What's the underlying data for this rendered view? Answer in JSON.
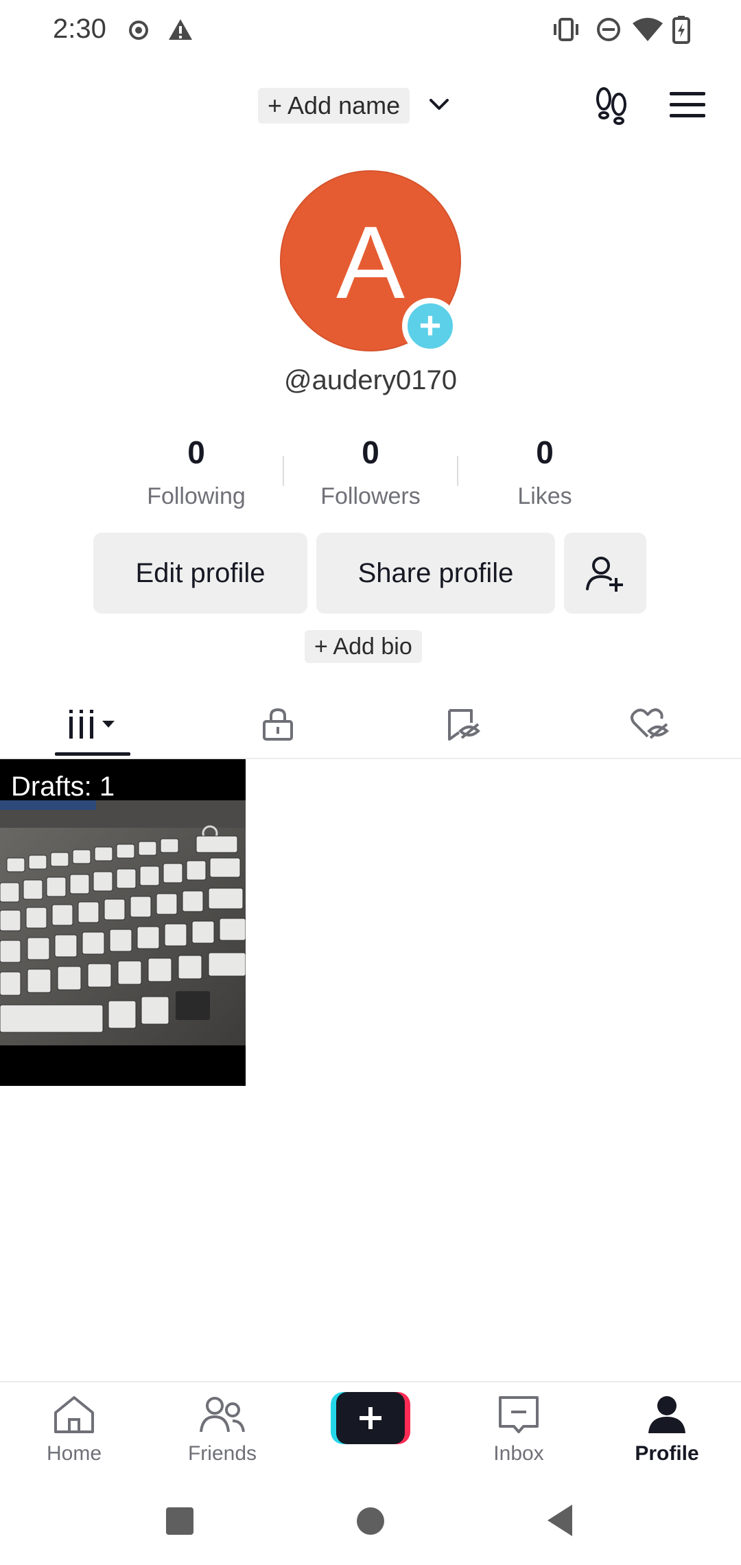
{
  "status_bar": {
    "time": "2:30",
    "icons": [
      "record-icon",
      "warning-icon",
      "vibrate-icon",
      "do-not-disturb-icon",
      "wifi-icon",
      "battery-charging-icon"
    ]
  },
  "header": {
    "add_name": "+ Add name",
    "icons": [
      "chevron-down-icon",
      "footprints-icon",
      "menu-icon"
    ]
  },
  "profile": {
    "avatar_letter": "A",
    "avatar_color": "#e65c32",
    "username": "@audery0170"
  },
  "stats": [
    {
      "value": "0",
      "label": "Following"
    },
    {
      "value": "0",
      "label": "Followers"
    },
    {
      "value": "0",
      "label": "Likes"
    }
  ],
  "actions": {
    "edit_profile": "Edit profile",
    "share_profile": "Share profile",
    "add_bio": "+ Add bio"
  },
  "tabs": [
    "grid-icon",
    "lock-icon",
    "repost-hidden-icon",
    "liked-hidden-icon"
  ],
  "drafts": {
    "label": "Drafts: 1"
  },
  "bottom_nav": [
    {
      "label": "Home",
      "icon": "home-icon",
      "active": false
    },
    {
      "label": "Friends",
      "icon": "friends-icon",
      "active": false
    },
    {
      "label": "",
      "icon": "create-icon",
      "active": false
    },
    {
      "label": "Inbox",
      "icon": "inbox-icon",
      "active": false
    },
    {
      "label": "Profile",
      "icon": "profile-icon",
      "active": true
    }
  ],
  "colors": {
    "accent_cyan": "#25f4ee",
    "accent_pink": "#fe2c55",
    "plus_badge": "#5bd0e8"
  }
}
